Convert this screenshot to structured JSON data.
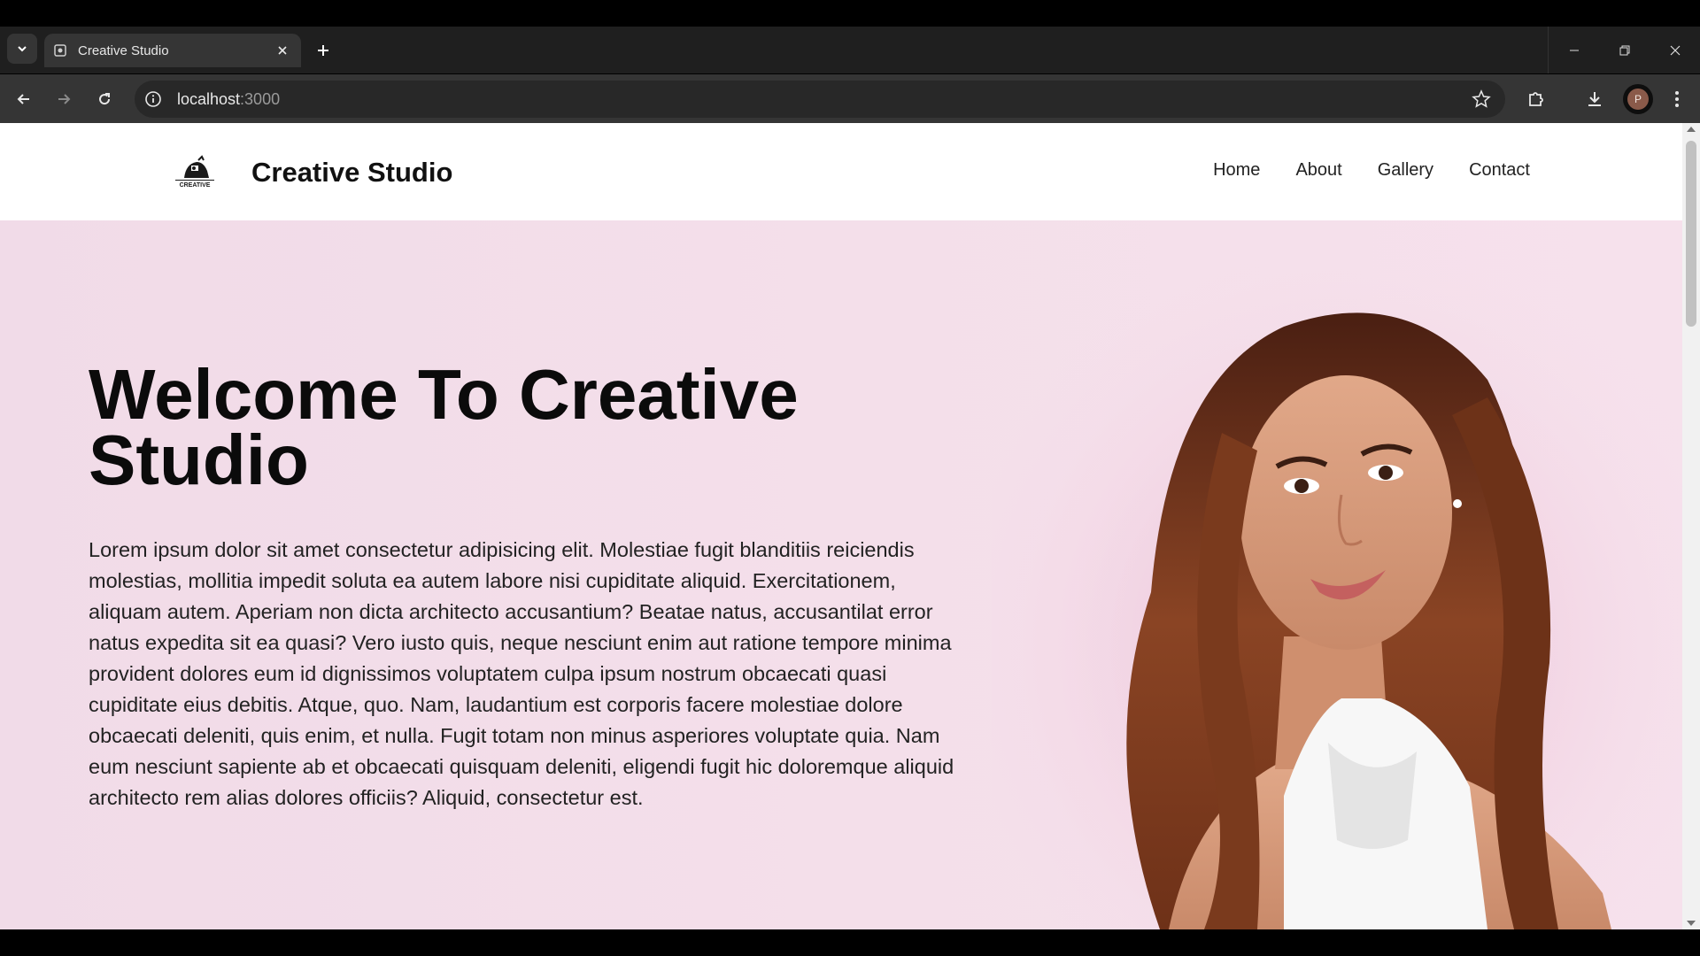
{
  "browser": {
    "tab": {
      "title": "Creative Studio"
    },
    "address": {
      "host": "localhost",
      "port": ":3000"
    },
    "profile_initial": "P"
  },
  "site": {
    "brand": "Creative Studio",
    "logo_text": "CREATIVE",
    "nav": [
      "Home",
      "About",
      "Gallery",
      "Contact"
    ]
  },
  "hero": {
    "title": "Welcome To Creative Studio",
    "body": "Lorem ipsum dolor sit amet consectetur adipisicing elit. Molestiae fugit blanditiis reiciendis molestias, mollitia impedit soluta ea autem labore nisi cupiditate aliquid. Exercitationem, aliquam autem. Aperiam non dicta architecto accusantium? Beatae natus, accusantilat error natus expedita sit ea quasi? Vero iusto quis, neque nesciunt enim aut ratione tempore minima provident dolores eum id dignissimos voluptatem culpa ipsum nostrum obcaecati quasi cupiditate eius debitis. Atque, quo. Nam, laudantium est corporis facere molestiae dolore obcaecati deleniti, quis enim, et nulla. Fugit totam non minus asperiores voluptate quia. Nam eum nesciunt sapiente ab et obcaecati quisquam deleniti, eligendi fugit hic doloremque aliquid architecto rem alias dolores officiis? Aliquid, consectetur est."
  },
  "colors": {
    "hero_bg": "#f4dfea",
    "chrome_dark": "#1f1f1f",
    "toolbar": "#353535"
  }
}
